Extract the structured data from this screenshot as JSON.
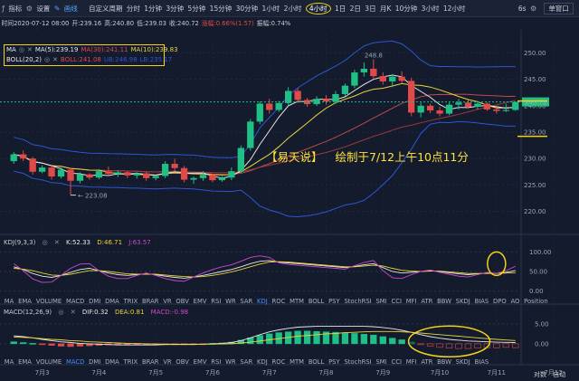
{
  "toolbar": {
    "items": [
      "指标",
      "设置",
      "画线",
      "自定义周期",
      "分时",
      "1分钟",
      "3分钟",
      "5分钟",
      "15分钟",
      "30分钟",
      "1小时",
      "2小时",
      "4小时",
      "1日",
      "2日",
      "3日",
      "月K",
      "10分钟",
      "3小时",
      "12小时"
    ],
    "active_period": "4小时",
    "right_value": "6s",
    "layout_select": "单窗口"
  },
  "infobar": {
    "time": "时间2020-07-12 08:00",
    "open": "开:239.16",
    "high": "高:240.80",
    "low": "低:239.03",
    "close": "收:240.72",
    "change": "涨幅:0.66%(1.57)",
    "amplitude": "振幅:0.74%"
  },
  "legend": {
    "ma_name": "MA",
    "ma5": "MA(5):239.19",
    "ma30": "MA(30):241.11",
    "ma10": "MA(10):239.83",
    "boll_name": "BOLL(20,2)",
    "boll_mid": "BOLL:241.08",
    "boll_up": "UB:246.98",
    "boll_lb": "LB:235.17"
  },
  "annotation": {
    "author": "【易天说】",
    "note": "绘制于7/12上午10点11分"
  },
  "kdj": {
    "name": "KDJ(9,3,3)",
    "k": "K:52.33",
    "d": "D:46.71",
    "j": "J:63.57"
  },
  "macd": {
    "name": "MACD(12,26,9)",
    "dif": "DIF:0.32",
    "dea": "DEA:0.81",
    "macd": "MACD:-0.98"
  },
  "indicator_tabs": {
    "tabs1": [
      "MA",
      "EMA",
      "VOLUME",
      "MACD",
      "DMI",
      "DMA",
      "TRIX",
      "BRAR",
      "VR",
      "OBV",
      "EMV",
      "RSI",
      "WR",
      "SAR",
      "KDJ",
      "ROC",
      "MTM",
      "BOLL",
      "PSY",
      "StochRSI",
      "SMI",
      "CCI",
      "MFI",
      "ATR",
      "BBW",
      "SKDJ",
      "BIAS",
      "DPO",
      "AO",
      "Position"
    ],
    "tabs1_active": "KDJ",
    "tabs2": [
      "MA",
      "EMA",
      "VOLUME",
      "MACD",
      "DMI",
      "DMA",
      "TRIX",
      "BRAR",
      "VR",
      "OBV",
      "EMV",
      "RSI",
      "WR",
      "SAR",
      "KDJ",
      "ROC",
      "MTM",
      "BOLL",
      "PSY",
      "StochRSI",
      "SMI",
      "CCI",
      "MFI",
      "ATR",
      "BBW",
      "SKDJ",
      "BIAS"
    ],
    "tabs2_active": "MACD"
  },
  "bottom": {
    "scale_mode": "对数",
    "auto": "自动"
  },
  "colors": {
    "up": "#1fbf86",
    "down": "#e04a4a",
    "ma5": "#e8e8e8",
    "ma10": "#ecd33a",
    "ma30": "#c04a4a",
    "boll_band": "#2f55d4",
    "kdj_k": "#e8e8e8",
    "kdj_d": "#ecd33a",
    "kdj_j": "#d04ad0",
    "highlight": "#f2d21a"
  },
  "chart_data": [
    {
      "type": "candlestick",
      "x_labels": [
        "7月3",
        "7月4",
        "7月5",
        "7月6",
        "7月7",
        "7月8",
        "7月9",
        "7月10",
        "7月11",
        "7月12"
      ],
      "y_ticks": [
        220.0,
        225.0,
        230.0,
        235.0,
        240.0,
        245.0,
        250.0
      ],
      "ylim": [
        216.5,
        253.5
      ],
      "current_price": "240.72",
      "high_label": "248.8",
      "low_label": "223.08",
      "candles": [
        [
          229.5,
          231.2,
          229.0,
          230.8
        ],
        [
          230.8,
          231.5,
          229.5,
          230.0
        ],
        [
          230.0,
          230.3,
          227.0,
          227.5
        ],
        [
          227.5,
          228.7,
          227.2,
          228.3
        ],
        [
          228.3,
          228.6,
          226.0,
          226.6
        ],
        [
          226.6,
          228.3,
          226.2,
          227.9
        ],
        [
          227.9,
          228.2,
          223.08,
          225.8
        ],
        [
          225.8,
          227.4,
          225.3,
          227.0
        ],
        [
          227.0,
          227.2,
          226.0,
          226.4
        ],
        [
          226.4,
          228.0,
          226.1,
          227.6
        ],
        [
          227.6,
          228.5,
          226.8,
          227.1
        ],
        [
          227.1,
          227.8,
          226.5,
          227.4
        ],
        [
          227.4,
          227.7,
          226.3,
          226.8
        ],
        [
          226.8,
          227.4,
          226.2,
          227.2
        ],
        [
          227.2,
          227.5,
          225.8,
          226.3
        ],
        [
          226.3,
          226.9,
          225.9,
          226.7
        ],
        [
          226.7,
          229.5,
          226.3,
          229.0
        ],
        [
          229.0,
          230.0,
          227.5,
          228.2
        ],
        [
          228.2,
          228.6,
          225.5,
          226.0
        ],
        [
          226.0,
          226.6,
          225.2,
          226.3
        ],
        [
          226.3,
          227.6,
          225.8,
          226.9
        ],
        [
          226.9,
          227.1,
          225.5,
          225.9
        ],
        [
          225.9,
          226.7,
          225.6,
          226.4
        ],
        [
          226.4,
          228.3,
          225.9,
          227.6
        ],
        [
          227.6,
          232.5,
          227.3,
          232.0
        ],
        [
          232.0,
          237.5,
          231.5,
          237.0
        ],
        [
          237.0,
          240.8,
          236.5,
          240.4
        ],
        [
          240.4,
          241.3,
          238.5,
          239.2
        ],
        [
          239.2,
          240.9,
          238.8,
          240.5
        ],
        [
          240.5,
          243.5,
          240.0,
          242.8
        ],
        [
          242.8,
          243.3,
          240.5,
          241.1
        ],
        [
          241.1,
          241.5,
          239.8,
          240.3
        ],
        [
          240.3,
          241.8,
          240.0,
          241.3
        ],
        [
          241.3,
          242.0,
          240.2,
          240.8
        ],
        [
          240.8,
          242.8,
          240.4,
          242.2
        ],
        [
          242.2,
          244.2,
          241.8,
          243.8
        ],
        [
          243.8,
          246.8,
          243.3,
          246.3
        ],
        [
          246.3,
          248.2,
          245.5,
          247.0
        ],
        [
          247.0,
          248.8,
          245.0,
          245.6
        ],
        [
          245.6,
          246.3,
          244.0,
          244.6
        ],
        [
          244.6,
          246.0,
          243.5,
          245.5
        ],
        [
          245.5,
          246.5,
          244.2,
          244.7
        ],
        [
          244.7,
          245.3,
          238.0,
          238.7
        ],
        [
          238.7,
          240.6,
          237.8,
          240.0
        ],
        [
          240.0,
          240.4,
          238.6,
          239.1
        ],
        [
          239.1,
          239.8,
          238.0,
          238.5
        ],
        [
          238.5,
          240.6,
          238.2,
          240.2
        ],
        [
          240.2,
          241.3,
          239.3,
          240.6
        ],
        [
          240.6,
          241.1,
          239.4,
          239.8
        ],
        [
          239.8,
          240.9,
          239.3,
          240.4
        ],
        [
          240.4,
          240.7,
          239.0,
          239.3
        ],
        [
          239.3,
          239.7,
          238.5,
          239.0
        ],
        [
          239.0,
          240.4,
          238.8,
          239.2
        ],
        [
          239.2,
          240.8,
          239.03,
          240.72
        ]
      ]
    },
    {
      "type": "line",
      "name": "KDJ(9,3,3)",
      "y_ticks": [
        0.0,
        50.0,
        100.0
      ],
      "ylim": [
        -10,
        110
      ],
      "series": [
        {
          "name": "K",
          "values": [
            62,
            55,
            45,
            38,
            35,
            40,
            48,
            55,
            58,
            52,
            46,
            42,
            40,
            42,
            44,
            42,
            38,
            35,
            33,
            36,
            40,
            45,
            50,
            55,
            62,
            70,
            76,
            78,
            74,
            72,
            70,
            68,
            66,
            64,
            62,
            60,
            63,
            67,
            70,
            60,
            50,
            46,
            48,
            50,
            52,
            50,
            47,
            44,
            42,
            44,
            46,
            45,
            48,
            52.33
          ]
        },
        {
          "name": "D",
          "values": [
            58,
            56,
            52,
            46,
            41,
            40,
            43,
            48,
            52,
            52,
            50,
            47,
            44,
            43,
            43,
            43,
            41,
            39,
            37,
            36,
            37,
            40,
            44,
            49,
            55,
            62,
            69,
            74,
            75,
            74,
            72,
            70,
            68,
            66,
            64,
            62,
            62,
            64,
            66,
            64,
            58,
            53,
            51,
            50,
            51,
            51,
            49,
            47,
            45,
            45,
            45,
            45,
            46,
            46.71
          ]
        },
        {
          "name": "J",
          "values": [
            70,
            52,
            31,
            22,
            23,
            40,
            58,
            69,
            70,
            52,
            38,
            32,
            32,
            40,
            46,
            40,
            32,
            27,
            25,
            36,
            46,
            55,
            62,
            67,
            76,
            86,
            90,
            86,
            72,
            68,
            66,
            64,
            62,
            60,
            58,
            56,
            65,
            73,
            78,
            52,
            34,
            32,
            42,
            50,
            54,
            48,
            43,
            38,
            36,
            42,
            48,
            45,
            52,
            63.57
          ]
        }
      ]
    },
    {
      "type": "bar",
      "name": "MACD(12,26,9)",
      "y_ticks": [
        0.0,
        5.0
      ],
      "ylim": [
        -3.0,
        7.5
      ],
      "values": [
        0.5,
        0.3,
        0.1,
        -0.2,
        -0.4,
        -0.6,
        -0.7,
        -0.6,
        -0.5,
        -0.4,
        -0.3,
        -0.25,
        -0.2,
        -0.2,
        -0.2,
        -0.15,
        -0.1,
        -0.05,
        -0.1,
        -0.1,
        -0.05,
        0.1,
        0.2,
        0.4,
        0.9,
        1.5,
        2.1,
        2.5,
        2.8,
        3.0,
        3.2,
        3.2,
        3.1,
        3.0,
        2.9,
        2.8,
        2.6,
        2.4,
        2.2,
        1.8,
        1.4,
        1.0,
        0.4,
        -0.2,
        -0.6,
        -0.9,
        -1.1,
        -1.2,
        -1.2,
        -1.1,
        -1.0,
        -1.0,
        -0.9,
        -0.98
      ],
      "dif": [
        2.0,
        1.8,
        1.5,
        1.1,
        0.8,
        0.5,
        0.3,
        0.1,
        0.0,
        -0.1,
        -0.2,
        -0.3,
        -0.3,
        -0.3,
        -0.3,
        -0.3,
        -0.2,
        -0.2,
        -0.2,
        -0.2,
        -0.1,
        0.0,
        0.1,
        0.3,
        0.8,
        1.5,
        2.3,
        3.0,
        3.5,
        3.9,
        4.2,
        4.3,
        4.4,
        4.4,
        4.4,
        4.4,
        4.4,
        4.4,
        4.3,
        4.1,
        3.8,
        3.4,
        2.9,
        2.3,
        1.8,
        1.4,
        1.1,
        0.9,
        0.7,
        0.6,
        0.5,
        0.4,
        0.35,
        0.32
      ],
      "dea": [
        1.7,
        1.6,
        1.5,
        1.3,
        1.1,
        1.0,
        0.8,
        0.7,
        0.5,
        0.4,
        0.3,
        0.2,
        0.1,
        0.05,
        0.0,
        -0.05,
        -0.1,
        -0.1,
        -0.1,
        -0.1,
        -0.1,
        -0.1,
        -0.05,
        0.0,
        0.2,
        0.4,
        0.7,
        1.0,
        1.3,
        1.6,
        1.9,
        2.1,
        2.3,
        2.5,
        2.6,
        2.8,
        2.9,
        3.0,
        3.1,
        3.1,
        3.1,
        3.0,
        2.9,
        2.7,
        2.5,
        2.3,
        2.1,
        1.9,
        1.7,
        1.5,
        1.3,
        1.1,
        0.95,
        0.81
      ]
    }
  ]
}
